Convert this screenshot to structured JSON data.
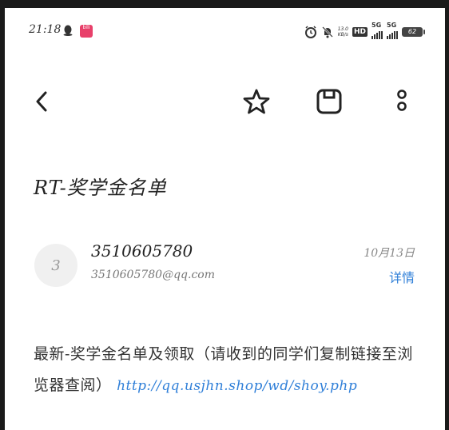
{
  "status_bar": {
    "time": "21:18",
    "net_speed_value": "13.0",
    "net_speed_unit": "KB/s",
    "hd_label": "HD",
    "sim1_label": "5G",
    "sim2_label": "5G",
    "battery_level": "62",
    "app_badge_text": "bili"
  },
  "toolbar": {
    "back_icon": "chevron-left-icon",
    "star_icon": "star-icon",
    "save_icon": "save-icon",
    "more_icon": "more-vertical-icon"
  },
  "mail": {
    "subject": "RT-奖学金名单",
    "avatar_letter": "3",
    "sender_name": "3510605780",
    "sender_email": "3510605780@qq.com",
    "date": "10月13日",
    "details_label": "详情",
    "body_text": "最新-奖学金名单及领取（请收到的同学们复制链接至浏览器查阅）",
    "body_link": "http://qq.usjhn.shop/wd/shoy.php"
  },
  "colors": {
    "link": "#2f7fd8",
    "text": "#222222",
    "background": "#ffffff"
  }
}
